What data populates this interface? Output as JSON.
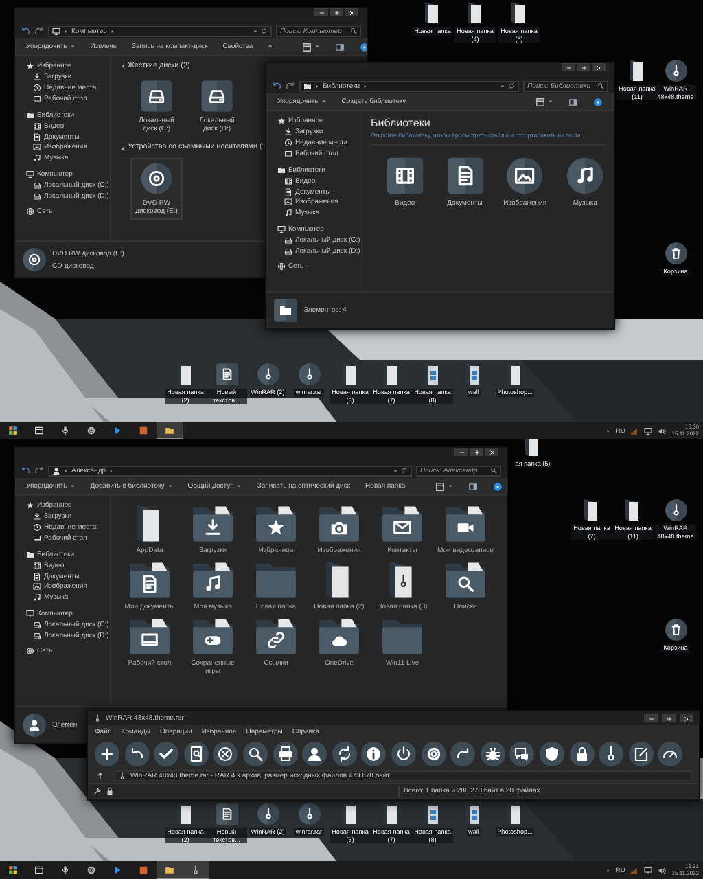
{
  "screens": [
    {
      "desktop_icons": [
        {
          "label": "Новая папка",
          "kind": "folder"
        },
        {
          "label": "Новая папка (4)",
          "kind": "folder"
        },
        {
          "label": "Новая папка (5)",
          "kind": "folder"
        },
        {
          "label": "Новая папка (11)",
          "kind": "folder"
        },
        {
          "label": "WinRAR 48x48.theme",
          "kind": "archive"
        },
        {
          "label": "Корзина",
          "kind": "trash"
        }
      ],
      "windows": [
        {
          "kind": "explorer",
          "location": "Компьютер",
          "search_placeholder": "Поиск: Компьютер",
          "toolbar": [
            {
              "label": "Упорядочить",
              "dropdown": true
            },
            {
              "label": "Извлечь",
              "dropdown": false
            },
            {
              "label": "Запись на компакт-диск",
              "dropdown": false
            },
            {
              "label": "Свойства",
              "dropdown": false
            },
            {
              "label": "»",
              "dropdown": false
            }
          ],
          "sidebar": [
            {
              "label": "Избранное",
              "children": [
                {
                  "label": "Загрузки"
                },
                {
                  "label": "Недавние места"
                },
                {
                  "label": "Рабочий стол"
                }
              ]
            },
            {
              "label": "Библиотеки",
              "children": [
                {
                  "label": "Видео"
                },
                {
                  "label": "Документы"
                },
                {
                  "label": "Изображения"
                },
                {
                  "label": "Музыка"
                }
              ]
            },
            {
              "label": "Компьютер",
              "children": [
                {
                  "label": "Локальный диск (C:)"
                },
                {
                  "label": "Локальный диск (D:)"
                }
              ]
            },
            {
              "label": "Сеть"
            }
          ],
          "content": {
            "kind": "drives",
            "groups": [
              {
                "title": "Жесткие диски (2)",
                "items": [
                  {
                    "label": "Локальный диск (C:)",
                    "kind": "drive",
                    "selected": false
                  },
                  {
                    "label": "Локальный диск (D:)",
                    "kind": "drive",
                    "selected": false
                  }
                ]
              },
              {
                "title": "Устройства со съемными носителями (1",
                "items": [
                  {
                    "label": "DVD RW дисковод (E:)",
                    "kind": "disc",
                    "selected": true
                  }
                ]
              }
            ]
          },
          "status": {
            "kind": "disc",
            "lines": [
              "DVD RW дисковод (E:)",
              "CD-дисковод"
            ]
          }
        },
        {
          "kind": "explorer",
          "location": "Библиотеки",
          "search_placeholder": "Поиск: Библиотеки",
          "toolbar": [
            {
              "label": "Упорядочить",
              "dropdown": true
            },
            {
              "label": "Создать библиотеку",
              "dropdown": false
            }
          ],
          "sidebar": [
            {
              "label": "Избранное",
              "children": [
                {
                  "label": "Загрузки"
                },
                {
                  "label": "Недавние места"
                },
                {
                  "label": "Рабочий стол"
                }
              ]
            },
            {
              "label": "Библиотеки",
              "children": [
                {
                  "label": "Видео"
                },
                {
                  "label": "Документы"
                },
                {
                  "label": "Изображения"
                },
                {
                  "label": "Музыка"
                }
              ]
            },
            {
              "label": "Компьютер",
              "children": [
                {
                  "label": "Локальный диск (C:)"
                },
                {
                  "label": "Локальный диск (D:)"
                }
              ]
            },
            {
              "label": "Сеть"
            }
          ],
          "content": {
            "kind": "libraries",
            "title": "Библиотеки",
            "subtitle": "Откройте библиотеку, чтобы просмотреть файлы и отсортировать их по па...",
            "items": [
              {
                "label": "Видео",
                "kind": "film"
              },
              {
                "label": "Документы",
                "kind": "document"
              },
              {
                "label": "Изображения",
                "kind": "image"
              },
              {
                "label": "Музыка",
                "kind": "music"
              }
            ]
          },
          "status": {
            "kind": "library",
            "lines": [
              "Элементов: 4"
            ]
          }
        }
      ],
      "desktop_row": [
        {
          "label": "Новая папка (2)",
          "kind": "folder"
        },
        {
          "label": "Новый текстов...",
          "kind": "document"
        },
        {
          "label": "WinRAR (2)",
          "kind": "archive"
        },
        {
          "label": "winrar.rar",
          "kind": "archive"
        },
        {
          "label": "Новая папка (3)",
          "kind": "folder"
        },
        {
          "label": "Новая папка (7)",
          "kind": "folder"
        },
        {
          "label": "Новая папка (8)",
          "kind": "picture-folder"
        },
        {
          "label": "wall",
          "kind": "picture-folder"
        },
        {
          "label": "Photoshop...",
          "kind": "folder"
        }
      ],
      "taskbar": {
        "apps": [
          {
            "active": false
          },
          {
            "active": false
          },
          {
            "active": false
          },
          {
            "active": false
          },
          {
            "active": false
          },
          {
            "active": false
          },
          {
            "active": true
          }
        ],
        "language": "RU",
        "time": "15:30",
        "date": "15.11.2022"
      }
    },
    {
      "desktop_icons": [
        {
          "label": "ая папка (5)",
          "kind": "folder"
        },
        {
          "label": "Новая папка (7)",
          "kind": "folder"
        },
        {
          "label": "Новая папка (11)",
          "kind": "folder"
        },
        {
          "label": "WinRAR 48x48.theme",
          "kind": "archive"
        },
        {
          "label": "Корзина",
          "kind": "trash"
        }
      ],
      "windows": [
        {
          "kind": "explorer",
          "location": "Александр",
          "search_placeholder": "Поиск: Александр",
          "toolbar": [
            {
              "label": "Упорядочить",
              "dropdown": true
            },
            {
              "label": "Добавить в библиотеку",
              "dropdown": true
            },
            {
              "label": "Общий доступ",
              "dropdown": true
            },
            {
              "label": "Записать на оптический диск",
              "dropdown": false
            },
            {
              "label": "Новая папка",
              "dropdown": false
            }
          ],
          "sidebar": [
            {
              "label": "Избранное",
              "children": [
                {
                  "label": "Загрузки"
                },
                {
                  "label": "Недавние места"
                },
                {
                  "label": "Рабочий стол"
                }
              ]
            },
            {
              "label": "Библиотеки",
              "children": [
                {
                  "label": "Видео"
                },
                {
                  "label": "Документы"
                },
                {
                  "label": "Изображения"
                },
                {
                  "label": "Музыка"
                }
              ]
            },
            {
              "label": "Компьютер",
              "children": [
                {
                  "label": "Локальный диск (C:)"
                },
                {
                  "label": "Локальный диск (D:)"
                }
              ]
            },
            {
              "label": "Сеть"
            }
          ],
          "content": {
            "kind": "folders",
            "items": [
              {
                "label": "AppData",
                "kind": "paper"
              },
              {
                "label": "Загрузки",
                "kind": "download"
              },
              {
                "label": "Избранное",
                "kind": "star"
              },
              {
                "label": "Изображения",
                "kind": "camera"
              },
              {
                "label": "Контакты",
                "kind": "mail"
              },
              {
                "label": "Мои видеозаписи",
                "kind": "video"
              },
              {
                "label": "Мои документы",
                "kind": "document"
              },
              {
                "label": "Моя музыка",
                "kind": "music"
              },
              {
                "label": "Новая папка",
                "kind": "plain"
              },
              {
                "label": "Новая папка (2)",
                "kind": "paper"
              },
              {
                "label": "Новая папка (3)",
                "kind": "archive"
              },
              {
                "label": "Поиски",
                "kind": "search"
              },
              {
                "label": "Рабочий стол",
                "kind": "desktop"
              },
              {
                "label": "Сохраненные игры",
                "kind": "game"
              },
              {
                "label": "Ссылки",
                "kind": "link"
              },
              {
                "label": "OneDrive",
                "kind": "cloud"
              },
              {
                "label": "Win11 Live",
                "kind": "plain"
              }
            ]
          },
          "status": {
            "kind": "person",
            "lines": [
              "Элемен"
            ]
          }
        },
        {
          "kind": "winrar",
          "title": "WinRAR 48x48.theme.rar",
          "menu": [
            "Файл",
            "Команды",
            "Операции",
            "Избранное",
            "Параметры",
            "Справка"
          ],
          "path": "WinRAR 48x48.theme.rar - RAR 4.x архив, размер исходных файлов 473 678 байт",
          "status": "Всего: 1 папка и 288 278 байт в 20 файлах"
        }
      ],
      "desktop_row": [
        {
          "label": "Новая папка (2)",
          "kind": "folder"
        },
        {
          "label": "Новый текстов...",
          "kind": "document"
        },
        {
          "label": "WinRAR (2)",
          "kind": "archive"
        },
        {
          "label": "winrar.rar",
          "kind": "archive"
        },
        {
          "label": "Новая папка (3)",
          "kind": "folder"
        },
        {
          "label": "Новая папка (7)",
          "kind": "folder"
        },
        {
          "label": "Новая папка (8)",
          "kind": "picture-folder"
        },
        {
          "label": "wall",
          "kind": "picture-folder"
        },
        {
          "label": "Photoshop...",
          "kind": "folder"
        }
      ],
      "taskbar": {
        "apps": [
          {
            "active": false
          },
          {
            "active": false
          },
          {
            "active": false
          },
          {
            "active": false
          },
          {
            "active": false
          },
          {
            "active": false
          },
          {
            "active": true
          },
          {
            "active": true
          }
        ],
        "language": "RU",
        "time": "15:31",
        "date": "15.11.2022"
      }
    }
  ]
}
